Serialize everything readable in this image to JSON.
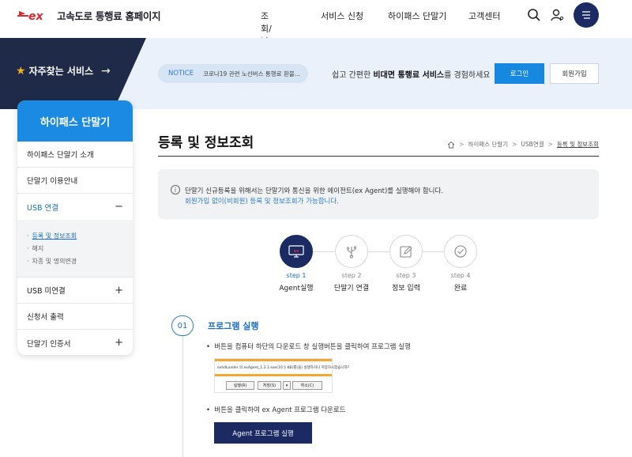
{
  "header": {
    "logo_text": "ex",
    "site_title": "고속도로 통행료 홈페이지",
    "nav": [
      "조회/납부",
      "서비스 신청",
      "하이패스 단말기",
      "고객센터"
    ]
  },
  "band": {
    "favorites_label": "자주찾는 서비스",
    "favorites_arrow": "→",
    "notice_tag": "NOTICE",
    "notice_text": "코로나19 관련 노선버스 통행료 환불...",
    "message_pre": "쉽고 간편한 ",
    "message_bold": "비대면 통행료 서비스",
    "message_post": "를 경험하세요",
    "login_label": "로그인",
    "join_label": "회원가입"
  },
  "sidebar": {
    "title": "하이패스 단말기",
    "items": [
      {
        "label": "하이패스 단말기 소개",
        "toggle": ""
      },
      {
        "label": "단말기 이용안내",
        "toggle": ""
      },
      {
        "label": "USB 연결",
        "toggle": "−"
      },
      {
        "label": "USB 미연결",
        "toggle": "+"
      },
      {
        "label": "신청서 출력",
        "toggle": ""
      },
      {
        "label": "단말기 인증서",
        "toggle": "+"
      }
    ],
    "sub_items": [
      {
        "bullet": "·",
        "label": "등록 및 정보조회"
      },
      {
        "bullet": "·",
        "label": "해지"
      },
      {
        "bullet": "·",
        "label": "차종 및 명의변경"
      }
    ]
  },
  "main": {
    "title": "등록 및 정보조회",
    "breadcrumb": [
      "하이패스 단말기",
      "USB연결",
      "등록 및 정보조회"
    ],
    "breadcrumb_sep": ">",
    "info_icon": "i",
    "info_line1": "단말기 신규등록을 위해서는 단말기와 통신을 위한 에이전트(ex Agent)를 실행해야 합니다.",
    "info_line2": "회원가입 없이(비회원) 등록 및 정보조회가 가능합니다.",
    "steps": [
      {
        "num": "step 1",
        "label": "Agent실행",
        "icon": "monitor-icon"
      },
      {
        "num": "step 2",
        "label": "단말기 연결",
        "icon": "usb-icon"
      },
      {
        "num": "step 3",
        "label": "정보 입력",
        "icon": "edit-icon"
      },
      {
        "num": "step 4",
        "label": "완료",
        "icon": "check-icon"
      }
    ],
    "section": {
      "num": "01",
      "title": "프로그램 실행",
      "bullet1": "버튼을 컴퓨터 하단의 다운로드 창 실행버튼을 클릭하여 프로그램 실행",
      "bullet2": "버튼을 클릭하여 ex Agent 프로그램 다운로드",
      "bullet_mark": "•",
      "dialog_text": "exhdLoader 의 exAgent_1.2.1.exe(10.5 KB)를(을) 실행하거나 저장하시겠습니까?",
      "dialog_run": "실행(R)",
      "dialog_save": "저장(S)",
      "dialog_drop": "▾",
      "dialog_cancel": "취소(C)",
      "agent_button": "Agent 프로그램 실행"
    }
  },
  "colors": {
    "navy": "#1b2a63",
    "blue": "#1a8ae3",
    "link_blue": "#2f7ccf",
    "brand_red": "#e0262f",
    "star": "#f3b11d"
  }
}
